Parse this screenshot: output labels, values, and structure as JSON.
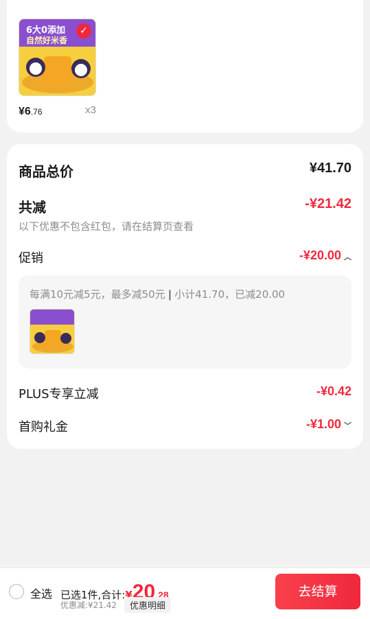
{
  "product": {
    "price_symbol": "¥",
    "price_integer": "6",
    "price_decimal": ".76",
    "quantity": "x3",
    "selected": true,
    "image_text_line1": "6大0添加",
    "image_text_line2": "自然好米香"
  },
  "summary": {
    "total_label": "商品总价",
    "total_value": "¥41.70",
    "reduction_label": "共减",
    "reduction_value": "-¥21.42",
    "reduction_note": "以下优惠不包含红包，请在结算页查看",
    "promo_label": "促销",
    "promo_value": "-¥20.00",
    "promo_rule": "每满10元减5元，最多减50元",
    "promo_subtotal": "小计41.70，已减20.00",
    "plus_label": "PLUS专享立减",
    "plus_value": "-¥0.42",
    "first_label": "首购礼金",
    "first_value": "-¥1.00"
  },
  "bottom_bar": {
    "select_all": "全选",
    "selected_text": "已选1件,合计:",
    "total_symbol": "¥",
    "total_integer": "20",
    "total_decimal": ".28",
    "discount_text": "优惠减:¥21.42",
    "detail_link": "优惠明细",
    "checkout_button": "去结算"
  },
  "colors": {
    "accent_red": "#f0283c",
    "background": "#f2f2f2",
    "card": "#ffffff",
    "muted_text": "#8c8c8c"
  }
}
